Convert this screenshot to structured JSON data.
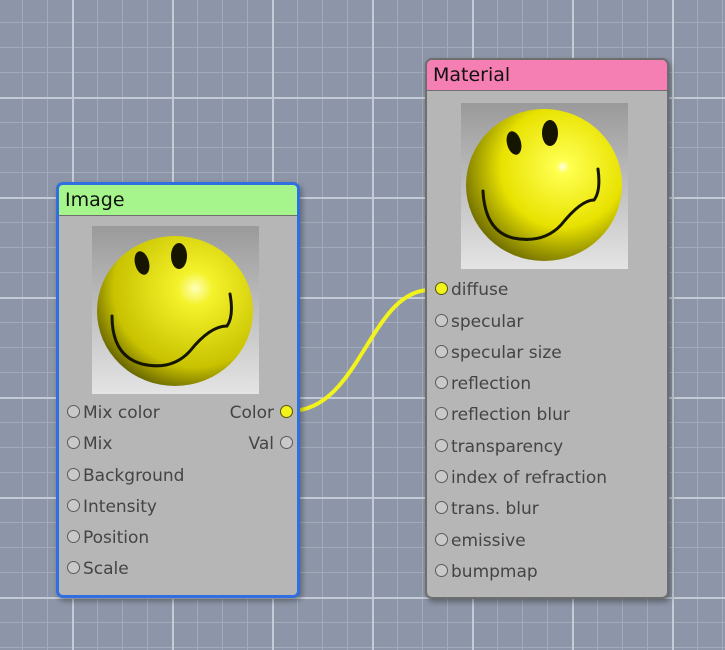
{
  "image_node": {
    "title": "Image",
    "header_color": "#a6f58c",
    "inputs": [
      "Mix color",
      "Mix",
      "Background",
      "Intensity",
      "Position",
      "Scale"
    ],
    "outputs": [
      "Color",
      "Val"
    ]
  },
  "material_node": {
    "title": "Material",
    "header_color": "#f57fb3",
    "inputs": [
      "diffuse",
      "specular",
      "specular size",
      "reflection",
      "reflection blur",
      "transparency",
      "index of refraction",
      "trans. blur",
      "emissive",
      "bumpmap"
    ]
  },
  "connection": {
    "from": "Color",
    "to": "diffuse",
    "color": "#f2f21c"
  },
  "colors": {
    "selection": "#2f6fe0",
    "port_active": "#f2f21c"
  }
}
